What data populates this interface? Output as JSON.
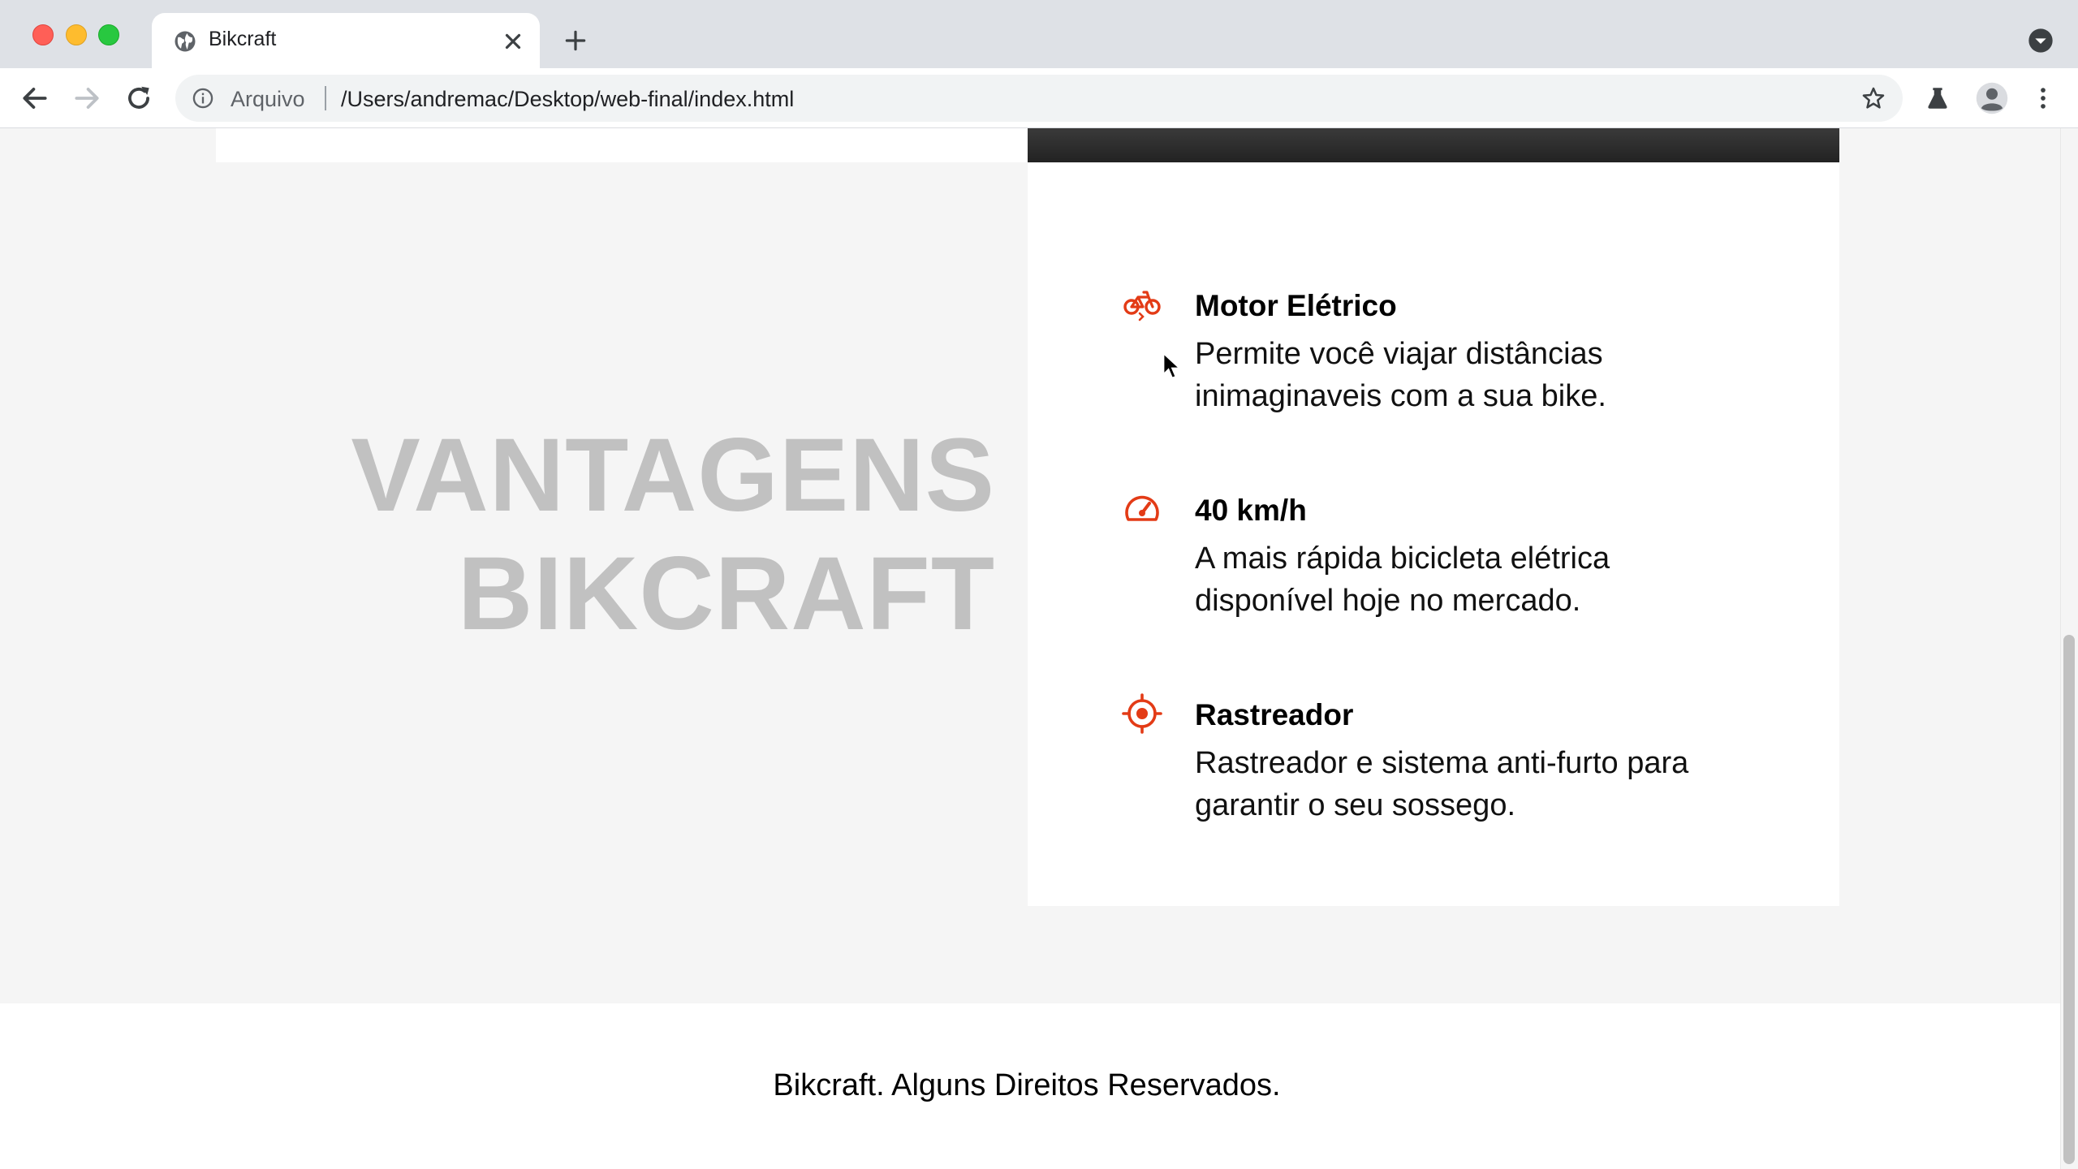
{
  "browser": {
    "tab_title": "Bikcraft",
    "omnibox_scheme": "Arquivo",
    "url": "/Users/andremac/Desktop/web-final/index.html"
  },
  "page": {
    "heading_line1": "VANTAGENS",
    "heading_line2": "BIKCRAFT",
    "features": [
      {
        "icon": "electric-bike-icon",
        "title": "Motor Elétrico",
        "desc_line1": "Permite você viajar distâncias",
        "desc_line2": "inimaginaveis com a sua bike."
      },
      {
        "icon": "speedometer-icon",
        "title": "40 km/h",
        "desc_line1": "A mais rápida bicicleta elétrica",
        "desc_line2": "disponível hoje no mercado."
      },
      {
        "icon": "target-icon",
        "title": "Rastreador",
        "desc_line1": "Rastreador e sistema anti-furto para",
        "desc_line2": "garantir o seu sossego."
      }
    ],
    "footer": "Bikcraft. Alguns Direitos Reservados."
  },
  "colors": {
    "accent": "#e33b16",
    "heading": "#c1c1c1",
    "page_bg": "#f5f5f5"
  }
}
